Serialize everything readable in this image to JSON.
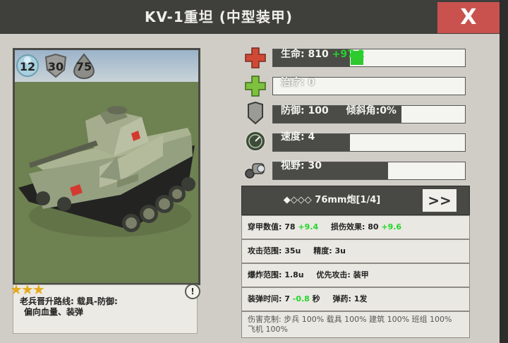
{
  "header": {
    "title": "KV-1重坦 (中型装甲)",
    "close_label": "X"
  },
  "badges": [
    "12",
    "30",
    "75"
  ],
  "stars": "★★★",
  "description": {
    "info": "!",
    "line1": "老兵晋升路线: 载具-防御:",
    "line2": "偏向血量、装弹"
  },
  "stats": {
    "hp": {
      "label": "生命:",
      "value": "810",
      "bonus": "+97.2",
      "fill": 0.4
    },
    "heal": {
      "label": "治疗:",
      "value": "0",
      "fill": 0
    },
    "defense": {
      "label": "防御:",
      "value": "100",
      "extra": "倾斜角:0%",
      "fill": 0.67
    },
    "speed": {
      "label": "速度:",
      "value": "4",
      "fill": 0.4
    },
    "vision": {
      "label": "视野:",
      "value": "30",
      "fill": 0.6
    }
  },
  "weapon": {
    "name": "◆◇◇◇ 76mm炮[1/4]",
    "next": ">>"
  },
  "weapon_info": {
    "pen_label": "穿甲数值:",
    "pen_value": "78",
    "pen_bonus": "+9.4",
    "dmg_label": "损伤效果:",
    "dmg_value": "80",
    "dmg_bonus": "+9.6",
    "range_label": "攻击范围:",
    "range_value": "35u",
    "acc_label": "精度:",
    "acc_value": "3u",
    "blast_label": "爆炸范围:",
    "blast_value": "1.8u",
    "prio_label": "优先攻击:",
    "prio_value": "装甲",
    "reload_label": "装弹时间:",
    "reload_value": "7",
    "reload_bonus": "-0.8",
    "reload_unit": "秒",
    "ammo_label": "弹药:",
    "ammo_value": "1发",
    "counter": "伤害克制: 步兵 100% 载具 100% 建筑 100% 班组 100% 飞机 100%"
  },
  "colors": {
    "accent_close": "#c9524f",
    "positive": "#23d629",
    "title_bar": "#3f3f3c"
  }
}
